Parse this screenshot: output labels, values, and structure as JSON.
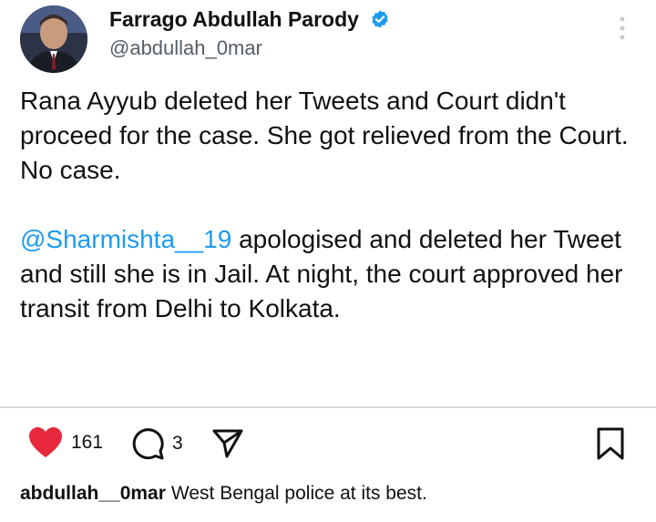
{
  "tweet": {
    "author_name": "Farrago Abdullah Parody",
    "handle": "@abdullah_0mar",
    "paragraph1": "Rana Ayyub deleted her Tweets and Court didn't proceed for the case. She got relieved from the Court. No case.",
    "paragraph2_mention": "@Sharmishta__19",
    "paragraph2_rest": " apologised and deleted her Tweet and still she is in Jail. At night, the court approved her transit from Delhi to Kolkata."
  },
  "post": {
    "likes": "161",
    "comments": "3",
    "caption_user": "abdullah__0mar",
    "caption_text": "West Bengal police at its best."
  },
  "colors": {
    "like_red": "#e8283c",
    "mention_blue": "#1d9bf0",
    "verified_blue": "#1d9bf0"
  },
  "icons": {
    "verified": "verified-badge-icon",
    "more": "more-vertical-icon",
    "like": "heart-icon",
    "comment": "comment-icon",
    "share": "send-icon",
    "save": "bookmark-icon"
  }
}
